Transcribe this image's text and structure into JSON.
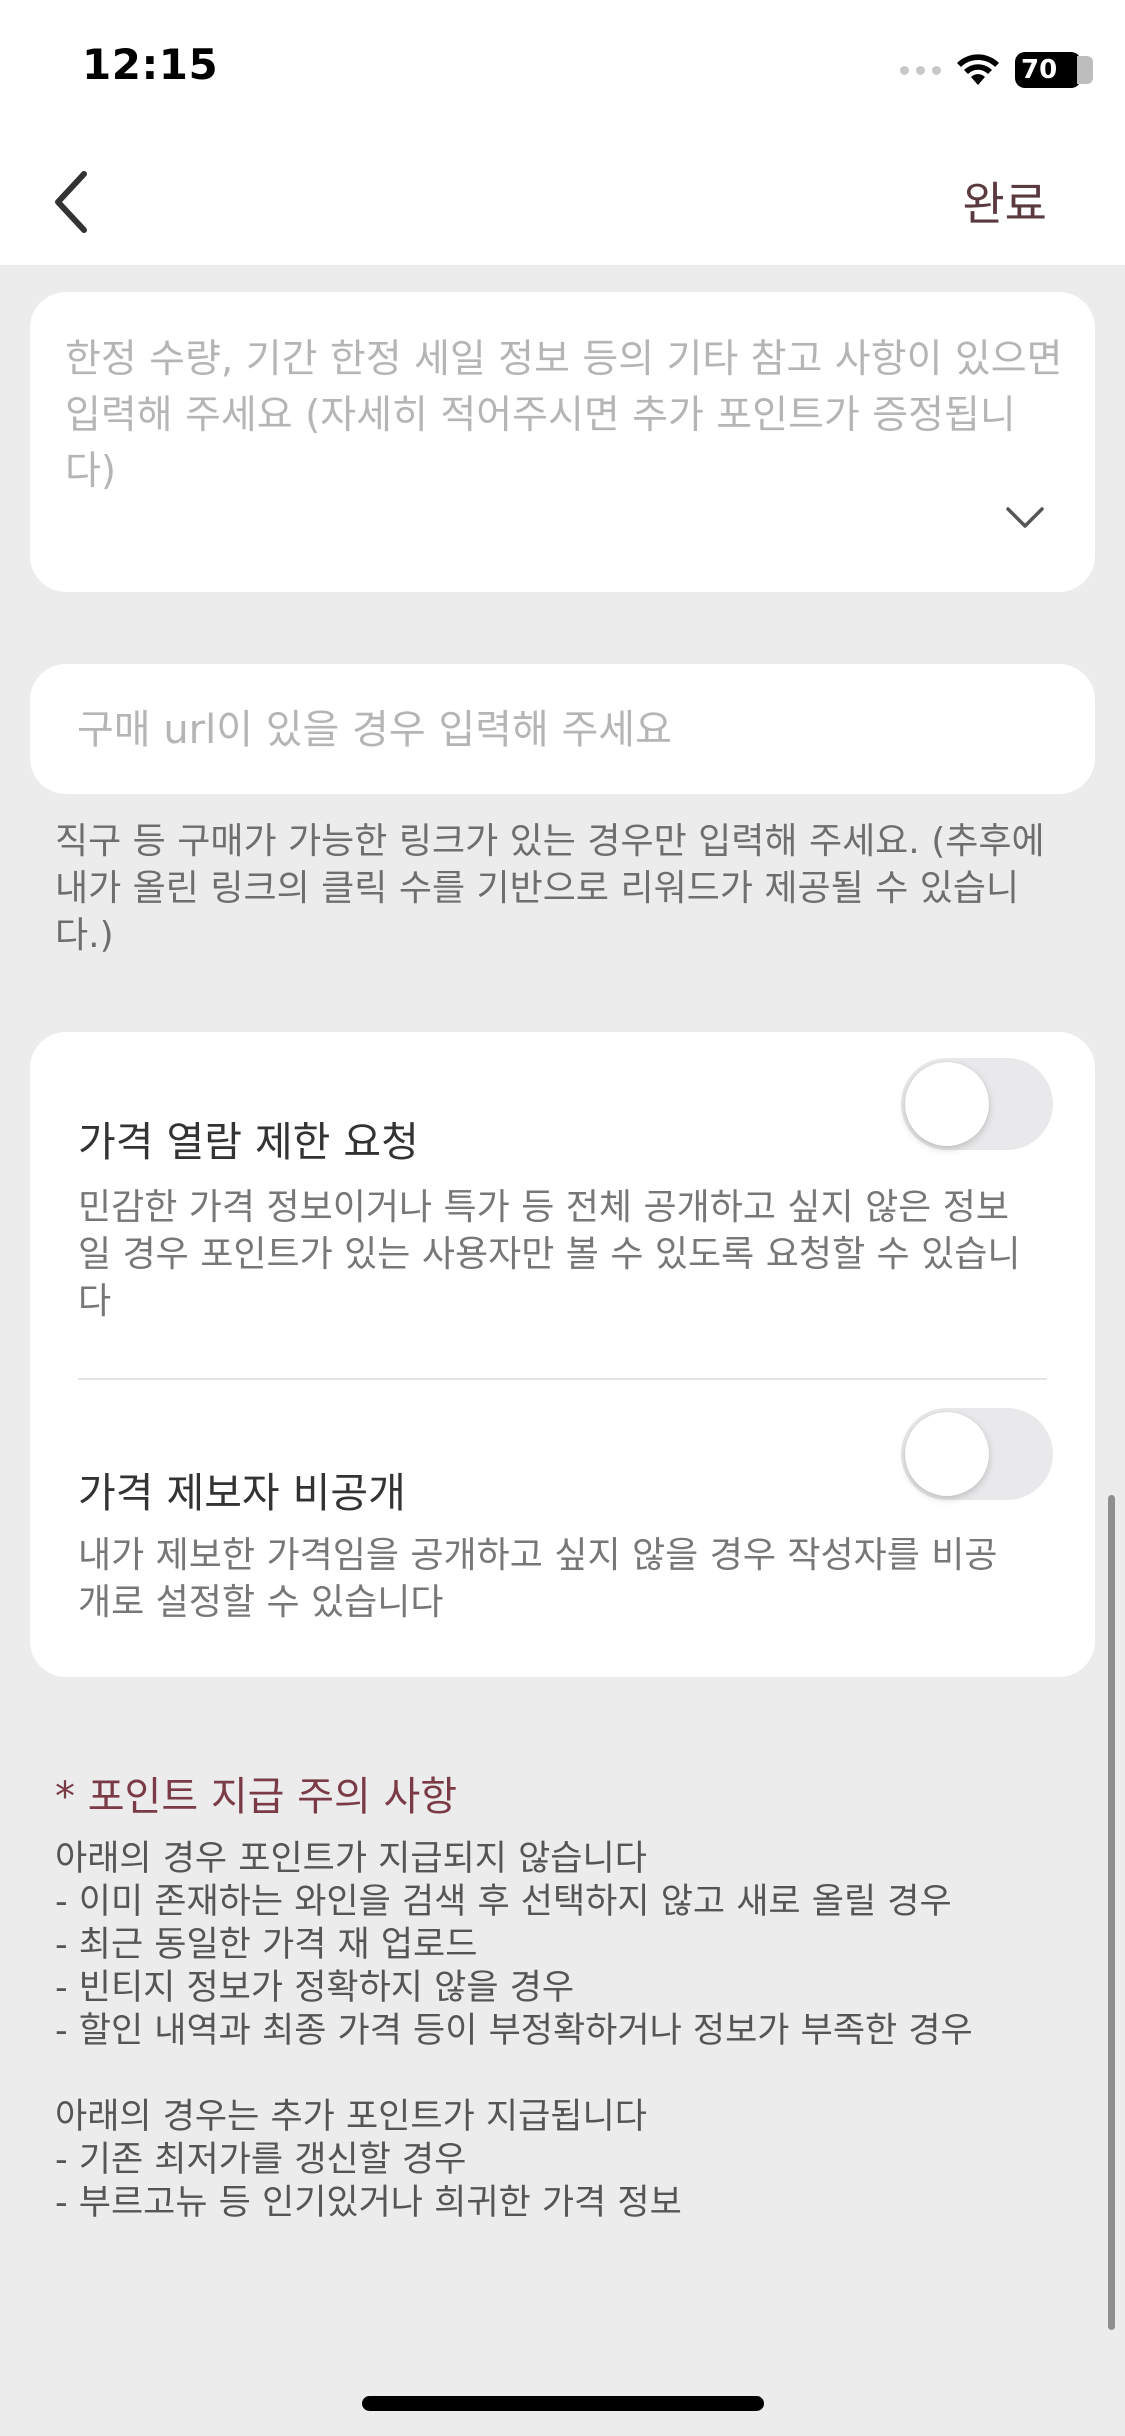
{
  "status_bar": {
    "time": "12:15",
    "battery": "70"
  },
  "nav": {
    "done_label": "완료"
  },
  "memo": {
    "placeholder": "한정 수량, 기간 한정 세일 정보 등의 기타 참고 사항이 있으면 입력해 주세요 (자세히 적어주시면 추가 포인트가 증정됩니다)"
  },
  "url": {
    "placeholder": "구매 url이 있을 경우 입력해 주세요",
    "hint": "직구 등 구매가 가능한 링크가 있는 경우만 입력해 주세요. (추후에 내가 올린 링크의 클릭 수를 기반으로 리워드가 제공될 수 있습니다.)"
  },
  "options": [
    {
      "title": "가격 열람 제한 요청",
      "description": "민감한 가격 정보이거나 특가 등 전체 공개하고 싶지 않은 정보일 경우 포인트가 있는 사용자만 볼 수 있도록 요청할 수 있습니다",
      "enabled": false
    },
    {
      "title": "가격 제보자 비공개",
      "description": "내가 제보한 가격임을 공개하고 싶지 않을 경우 작성자를 비공개로 설정할 수 있습니다",
      "enabled": false
    }
  ],
  "notice": {
    "title": "* 포인트 지급 주의 사항",
    "no_points_heading": "아래의 경우 포인트가 지급되지 않습니다",
    "no_points_items": [
      "- 이미 존재하는 와인을 검색 후 선택하지 않고 새로 올릴 경우",
      "- 최근 동일한 가격 재 업로드",
      "- 빈티지 정보가 정확하지 않을 경우",
      "- 할인 내역과 최종 가격 등이 부정확하거나 정보가 부족한 경우"
    ],
    "bonus_heading": "아래의 경우는 추가 포인트가 지급됩니다",
    "bonus_items": [
      "- 기존 최저가를 갱신할 경우",
      "- 부르고뉴 등 인기있거나 희귀한 가격 정보"
    ]
  },
  "colors": {
    "accent": "#7a3b46",
    "done": "#5a3a3f",
    "background": "#ececec"
  }
}
